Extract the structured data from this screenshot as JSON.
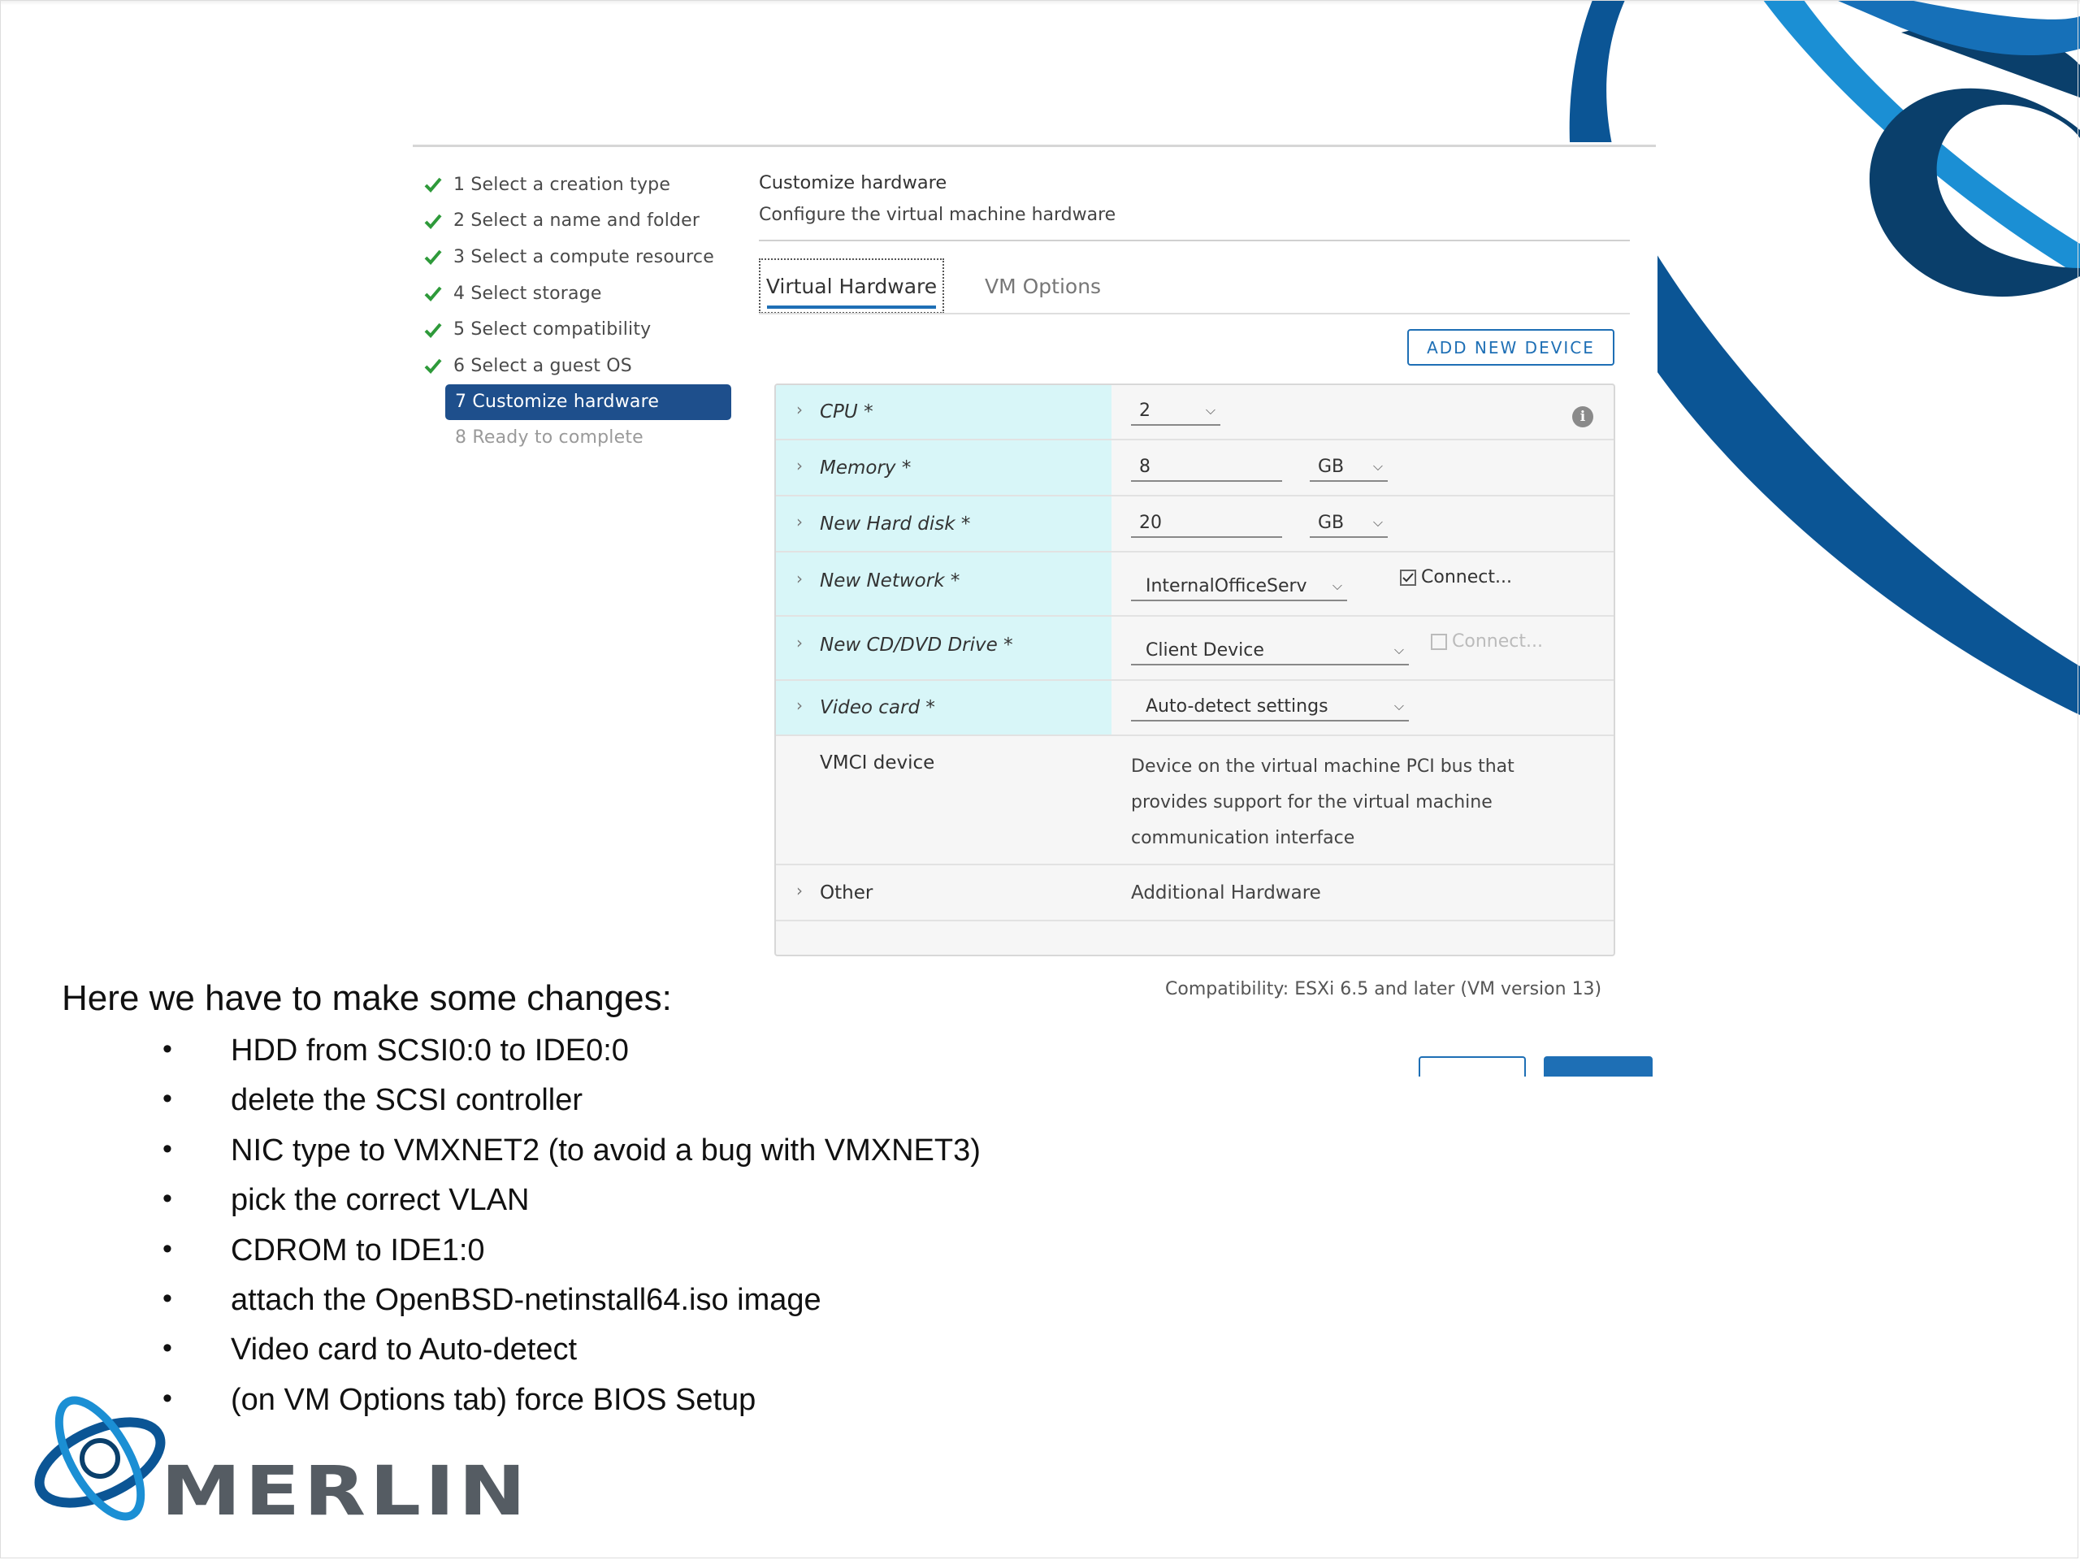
{
  "wizard": {
    "steps": [
      {
        "label": "1 Select a creation type"
      },
      {
        "label": "2 Select a name and folder"
      },
      {
        "label": "3 Select a compute resource"
      },
      {
        "label": "4 Select storage"
      },
      {
        "label": "5 Select compatibility"
      },
      {
        "label": "6 Select a guest OS"
      },
      {
        "label": "7 Customize hardware"
      },
      {
        "label": "8 Ready to complete"
      }
    ]
  },
  "header": {
    "title": "Customize hardware",
    "subtitle": "Configure the virtual machine hardware"
  },
  "tabs": {
    "virtual_hardware": "Virtual Hardware",
    "vm_options": "VM Options"
  },
  "add_device_label": "ADD NEW DEVICE",
  "hardware": {
    "cpu": {
      "label": "CPU *",
      "value": "2"
    },
    "memory": {
      "label": "Memory *",
      "value": "8",
      "unit": "GB"
    },
    "hard_disk": {
      "label": "New Hard disk *",
      "value": "20",
      "unit": "GB"
    },
    "network": {
      "label": "New Network *",
      "value": "InternalOfficeServ",
      "connect_label": "Connect..."
    },
    "cd_dvd": {
      "label": "New CD/DVD Drive *",
      "value": "Client Device",
      "connect_label": "Connect..."
    },
    "video": {
      "label": "Video card *",
      "value": "Auto-detect settings"
    },
    "vmci": {
      "label": "VMCI device",
      "desc_lines": [
        "Device on the virtual machine PCI bus that",
        "provides support for the virtual machine",
        "communication interface"
      ]
    },
    "other": {
      "label": "Other",
      "value": "Additional Hardware"
    }
  },
  "compatibility": "Compatibility: ESXi 6.5 and later (VM version 13)",
  "notes": {
    "title": "Here we have to make some changes:",
    "items": [
      "HDD from SCSI0:0 to IDE0:0",
      "delete the SCSI controller",
      "NIC type to VMXNET2 (to avoid a bug with VMXNET3)",
      "pick the correct VLAN",
      "CDROM to IDE1:0",
      "attach the OpenBSD-netinstall64.iso image",
      "Video card to Auto-detect",
      "(on VM Options tab) force BIOS Setup"
    ]
  },
  "logo": {
    "text": "MERLIN"
  },
  "colors": {
    "accent": "#1e6fb5",
    "active_step": "#1e4f8c",
    "label_bg": "#d8f6f8",
    "check": "#2e9a3a",
    "swirl_dark": "#0b4f8a",
    "swirl_light": "#1b8fd4"
  },
  "icons": {
    "check": "check-icon",
    "chevron": "chevron-right-icon",
    "dropdown": "chevron-down-icon",
    "info": "info-icon"
  }
}
